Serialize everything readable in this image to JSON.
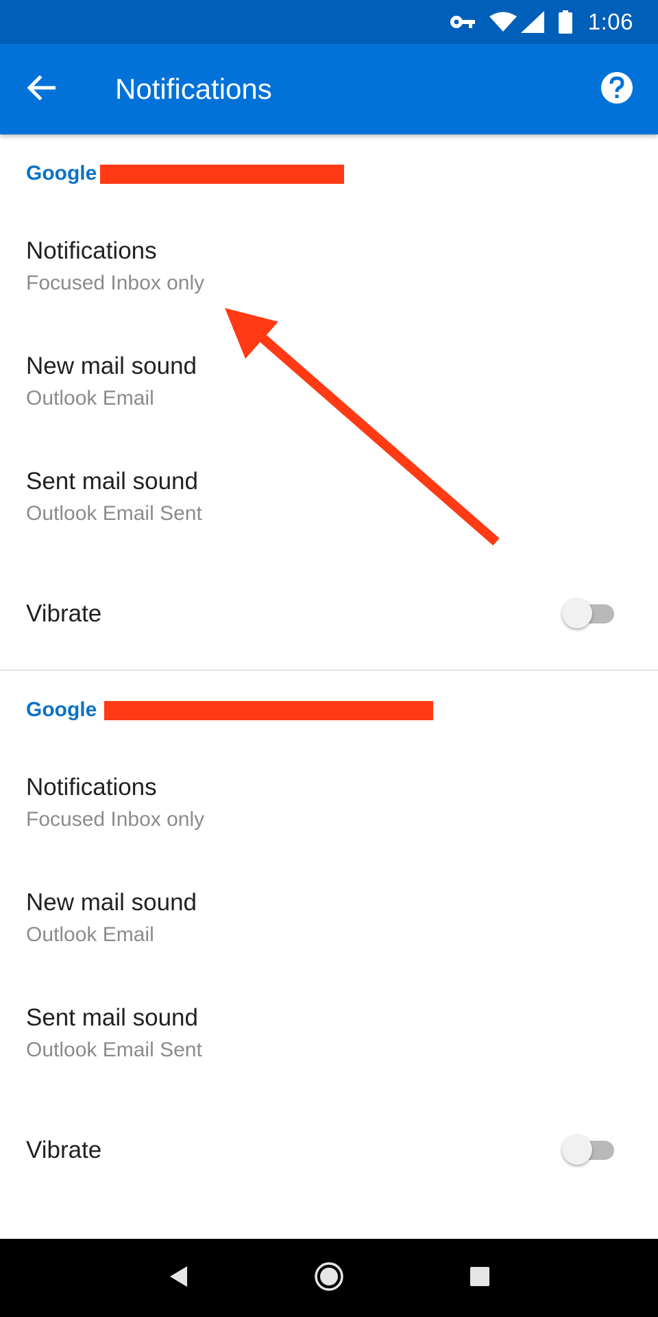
{
  "status_bar": {
    "time": "1:06",
    "icons": [
      "vpn-key-icon",
      "wifi-icon",
      "cell-signal-icon",
      "battery-icon"
    ]
  },
  "app_bar": {
    "title": "Notifications",
    "back_icon": "arrow-left-icon",
    "help_icon": "help-circle-icon"
  },
  "accounts": [
    {
      "header": "Google",
      "items": [
        {
          "label": "Notifications",
          "value": "Focused Inbox only"
        },
        {
          "label": "New mail sound",
          "value": "Outlook Email"
        },
        {
          "label": "Sent mail sound",
          "value": "Outlook Email Sent"
        }
      ],
      "vibrate": {
        "label": "Vibrate",
        "on": false
      }
    },
    {
      "header": "Google",
      "items": [
        {
          "label": "Notifications",
          "value": "Focused Inbox only"
        },
        {
          "label": "New mail sound",
          "value": "Outlook Email"
        },
        {
          "label": "Sent mail sound",
          "value": "Outlook Email Sent"
        }
      ],
      "vibrate": {
        "label": "Vibrate",
        "on": false
      }
    }
  ],
  "nav_bar": {
    "icons": [
      "back-triangle-icon",
      "home-circle-icon",
      "recents-square-icon"
    ]
  },
  "colors": {
    "status_bar": "#005fb8",
    "app_bar": "#0272d9",
    "section_header": "#0b72c6",
    "annotation": "#ff3a14"
  }
}
